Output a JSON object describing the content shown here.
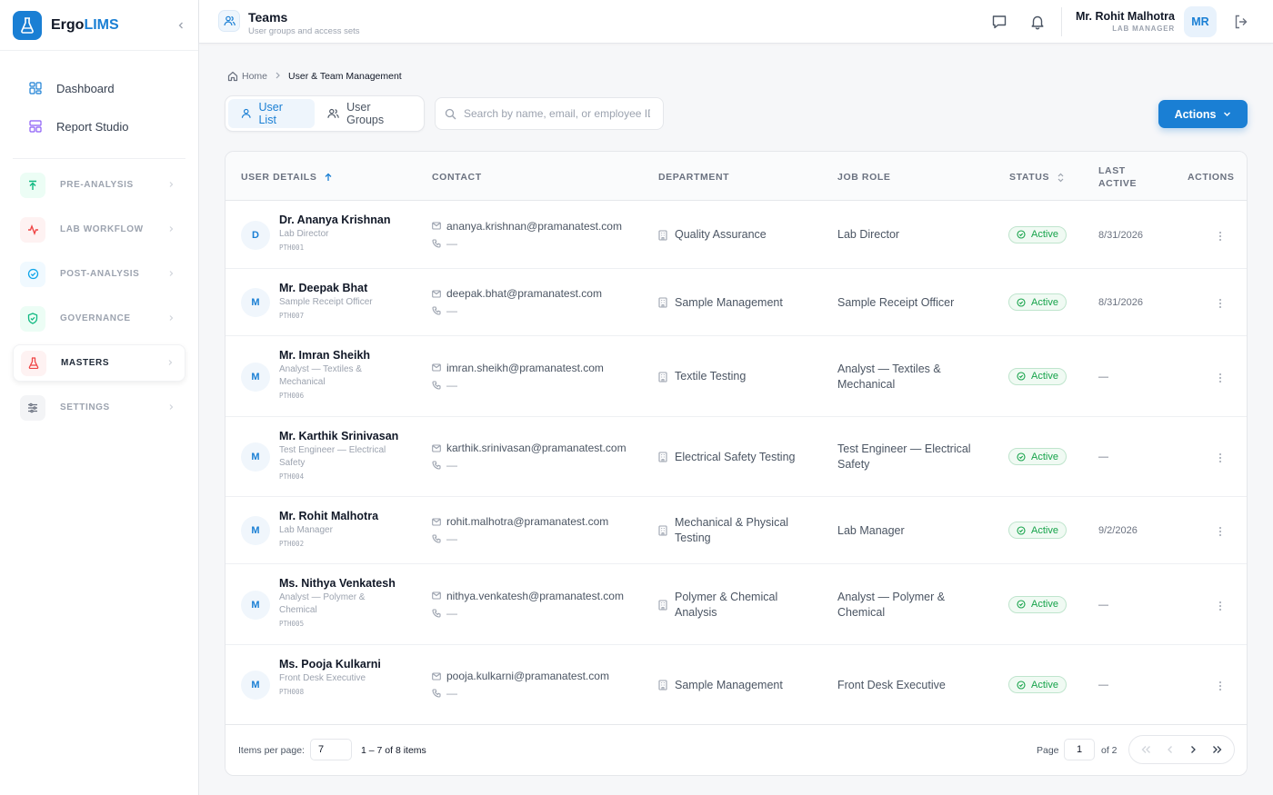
{
  "brand": {
    "name_part1": "Ergo",
    "name_part2": "LIMS"
  },
  "sidebar": {
    "top_items": [
      {
        "label": "Dashboard",
        "icon": "grid-icon"
      },
      {
        "label": "Report Studio",
        "icon": "layout-icon"
      }
    ],
    "sections": [
      {
        "label": "PRE-ANALYSIS",
        "icon": "upload-arrow-icon",
        "color": "#10b981",
        "bg": "#ecfdf5"
      },
      {
        "label": "LAB WORKFLOW",
        "icon": "activity-icon",
        "color": "#ef4444",
        "bg": "#fef2f2"
      },
      {
        "label": "POST-ANALYSIS",
        "icon": "check-circle-icon",
        "color": "#0ea5e9",
        "bg": "#f0f9ff"
      },
      {
        "label": "GOVERNANCE",
        "icon": "shield-check-icon",
        "color": "#10b981",
        "bg": "#ecfdf5"
      },
      {
        "label": "MASTERS",
        "icon": "flask-icon",
        "color": "#ef4444",
        "bg": "#fef2f2"
      },
      {
        "label": "SETTINGS",
        "icon": "sliders-icon",
        "color": "#6b7280",
        "bg": "#f3f4f6"
      }
    ]
  },
  "header": {
    "title": "Teams",
    "subtitle": "User groups and access sets",
    "user_name": "Mr. Rohit Malhotra",
    "user_role": "LAB MANAGER",
    "user_initials": "MR"
  },
  "breadcrumb": {
    "home": "Home",
    "current": "User & Team Management"
  },
  "tabs": {
    "user_list": "User List",
    "user_groups": "User Groups"
  },
  "search": {
    "placeholder": "Search by name, email, or employee ID"
  },
  "actions_label": "Actions",
  "table": {
    "headers": {
      "user_details": "USER DETAILS",
      "contact": "CONTACT",
      "department": "DEPARTMENT",
      "job_role": "JOB ROLE",
      "status": "STATUS",
      "last_active_1": "LAST",
      "last_active_2": "ACTIVE",
      "actions": "ACTIONS"
    },
    "rows": [
      {
        "initial": "D",
        "name": "Dr. Ananya Krishnan",
        "role": "Lab Director",
        "id": "PTH001",
        "email": "ananya.krishnan@pramanatest.com",
        "phone": "—",
        "department": "Quality Assurance",
        "job_role": "Lab Director",
        "status": "Active",
        "last_active": "8/31/2026"
      },
      {
        "initial": "M",
        "name": "Mr. Deepak Bhat",
        "role": "Sample Receipt Officer",
        "id": "PTH007",
        "email": "deepak.bhat@pramanatest.com",
        "phone": "—",
        "department": "Sample Management",
        "job_role": "Sample Receipt Officer",
        "status": "Active",
        "last_active": "8/31/2026"
      },
      {
        "initial": "M",
        "name": "Mr. Imran Sheikh",
        "role": "Analyst — Textiles & Mechanical",
        "id": "PTH006",
        "email": "imran.sheikh@pramanatest.com",
        "phone": "—",
        "department": "Textile Testing",
        "job_role": "Analyst — Textiles & Mechanical",
        "status": "Active",
        "last_active": "—"
      },
      {
        "initial": "M",
        "name": "Mr. Karthik Srinivasan",
        "role": "Test Engineer — Electrical Safety",
        "id": "PTH004",
        "email": "karthik.srinivasan@pramanatest.com",
        "phone": "—",
        "department": "Electrical Safety Testing",
        "job_role": "Test Engineer — Electrical Safety",
        "status": "Active",
        "last_active": "—"
      },
      {
        "initial": "M",
        "name": "Mr. Rohit Malhotra",
        "role": "Lab Manager",
        "id": "PTH002",
        "email": "rohit.malhotra@pramanatest.com",
        "phone": "—",
        "department": "Mechanical & Physical Testing",
        "job_role": "Lab Manager",
        "status": "Active",
        "last_active": "9/2/2026"
      },
      {
        "initial": "M",
        "name": "Ms. Nithya Venkatesh",
        "role": "Analyst — Polymer & Chemical",
        "id": "PTH005",
        "email": "nithya.venkatesh@pramanatest.com",
        "phone": "—",
        "department": "Polymer & Chemical Analysis",
        "job_role": "Analyst — Polymer & Chemical",
        "status": "Active",
        "last_active": "—"
      },
      {
        "initial": "M",
        "name": "Ms. Pooja Kulkarni",
        "role": "Front Desk Executive",
        "id": "PTH008",
        "email": "pooja.kulkarni@pramanatest.com",
        "phone": "—",
        "department": "Sample Management",
        "job_role": "Front Desk Executive",
        "status": "Active",
        "last_active": "—"
      }
    ]
  },
  "pagination": {
    "items_per_page_label": "Items per page:",
    "items_per_page": "7",
    "range": "1 – 7 of 8 items",
    "page_label": "Page",
    "page": "1",
    "of_label": "of 2"
  },
  "colors": {
    "accent": "#1a7fd4",
    "active_green": "#16a34a"
  }
}
